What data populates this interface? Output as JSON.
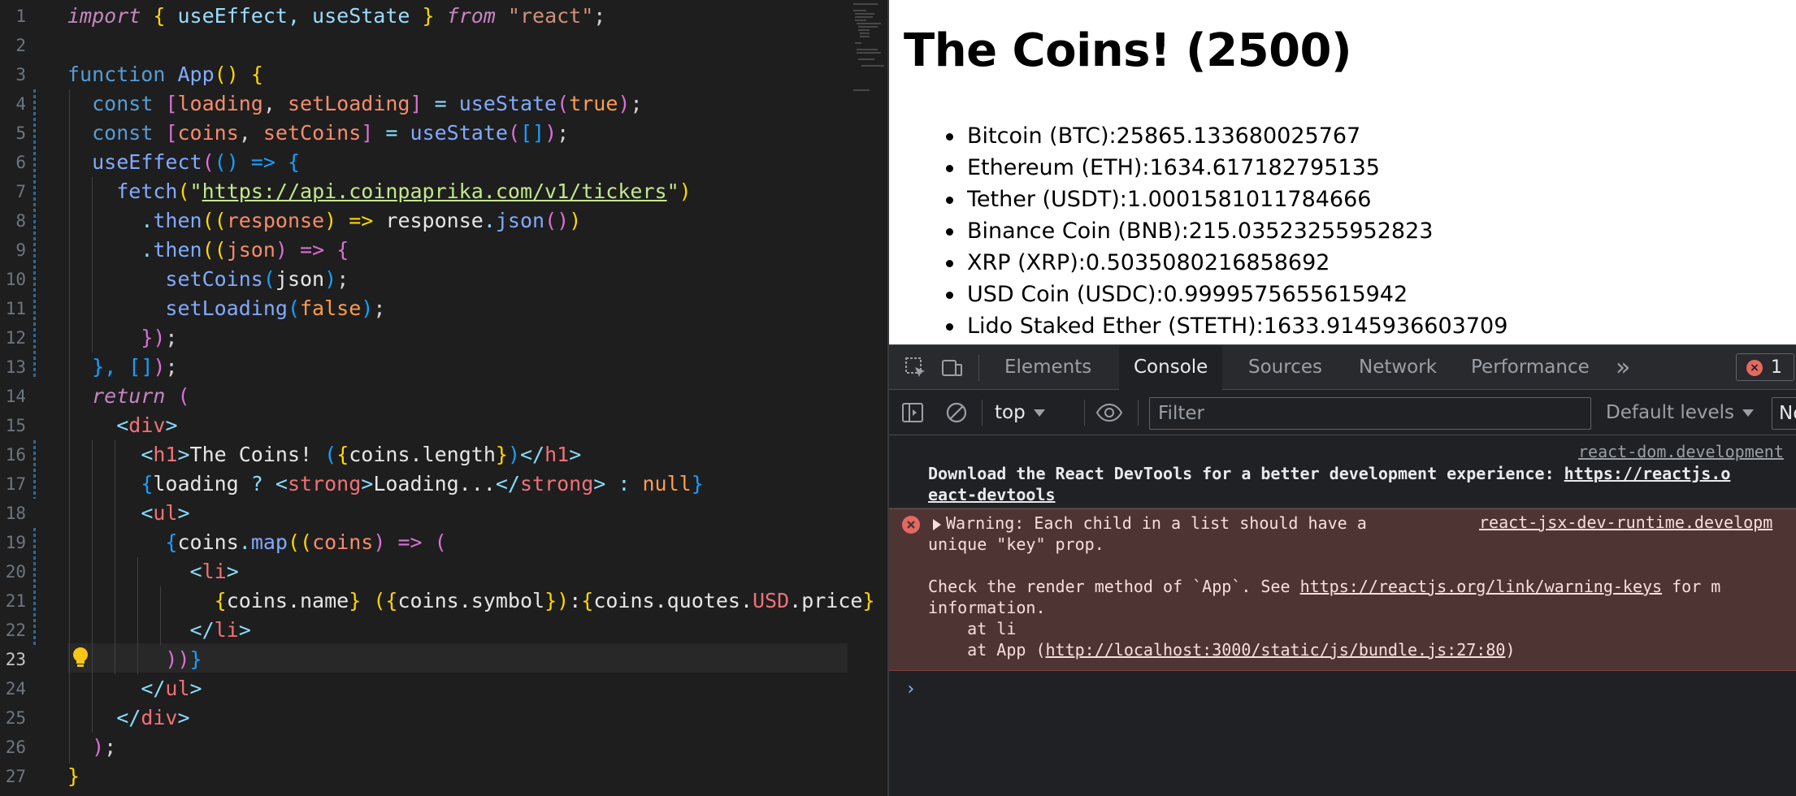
{
  "editor": {
    "line_numbers": [
      "1",
      "2",
      "3",
      "4",
      "5",
      "6",
      "7",
      "8",
      "9",
      "10",
      "11",
      "12",
      "13",
      "14",
      "15",
      "16",
      "17",
      "18",
      "19",
      "20",
      "21",
      "22",
      "23",
      "24",
      "25",
      "26",
      "27"
    ],
    "code": {
      "l1": {
        "import": "import",
        "open": "{",
        "names": " useEffect, useState ",
        "close": "}",
        "from": "from",
        "module": "\"react\"",
        "semi": ";"
      },
      "l3": {
        "function": "function",
        "name": "App",
        "parens": "()",
        "brace": "{"
      },
      "l4": {
        "const": "const",
        "open": "[",
        "a": "loading",
        "comma": ", ",
        "b": "setLoading",
        "close": "]",
        "eq": " = ",
        "fn": "useState",
        "p1": "(",
        "arg": "true",
        "p2": ")",
        "semi": ";"
      },
      "l5": {
        "const": "const",
        "open": "[",
        "a": "coins",
        "comma": ", ",
        "b": "setCoins",
        "close": "]",
        "eq": " = ",
        "fn": "useState",
        "p1": "(",
        "arg": "[]",
        "p2": ")",
        "semi": ";"
      },
      "l6": {
        "fn": "useEffect",
        "p1": "(",
        "arrow": "() => ",
        "brace": "{"
      },
      "l7": {
        "fn": "fetch",
        "p1": "(",
        "q1": "\"",
        "url": "https://api.coinpaprika.com/v1/tickers",
        "q2": "\"",
        "p2": ")"
      },
      "l8": {
        "dot": ".",
        "then": "then",
        "p1": "((",
        "arg": "response",
        "mid": ") => ",
        "obj": "response",
        "dot2": ".",
        "json": "json",
        "call": "()",
        "p2": ")"
      },
      "l9": {
        "dot": ".",
        "then": "then",
        "p1": "((",
        "arg": "json",
        "mid": ") => ",
        "brace": "{"
      },
      "l10": {
        "fn": "setCoins",
        "p1": "(",
        "arg": "json",
        "p2": ")",
        "semi": ";"
      },
      "l11": {
        "fn": "setLoading",
        "p1": "(",
        "arg": "false",
        "p2": ")",
        "semi": ";"
      },
      "l12": {
        "close": "})",
        "semi": ";"
      },
      "l13": {
        "close": "}, ",
        "arr": "[]",
        "p": ")",
        "semi": ";"
      },
      "l14": {
        "return": "return",
        "p": "("
      },
      "l15": {
        "lt": "<",
        "tag": "div",
        "gt": ">"
      },
      "l16": {
        "lt": "<",
        "tag": "h1",
        "gt": ">",
        "text": "The Coins! ",
        "p1": "(",
        "b1": "{",
        "expr": "coins.length",
        "b2": "}",
        "p2": ")",
        "lt2": "</",
        "tag2": "h1",
        "gt2": ">"
      },
      "l17": {
        "b1": "{",
        "cond": "loading",
        "q": " ? ",
        "lt": "<",
        "tag": "strong",
        "gt": ">",
        "text": "Loading...",
        "lt2": "</",
        "tag2": "strong",
        "gt2": ">",
        "colon": " : ",
        "null": "null",
        "b2": "}"
      },
      "l18": {
        "lt": "<",
        "tag": "ul",
        "gt": ">"
      },
      "l19": {
        "b1": "{",
        "obj": "coins",
        "dot": ".",
        "fn": "map",
        "p1": "((",
        "arg": "coins",
        "mid": ") => ",
        "p2": "("
      },
      "l20": {
        "lt": "<",
        "tag": "li",
        "gt": ">"
      },
      "l21": {
        "b1": "{",
        "e1": "coins.name",
        "b2": "}",
        "sp": " ",
        "p1": "(",
        "b3": "{",
        "e2": "coins.symbol",
        "b4": "}",
        "p2": ")",
        "colon": ":",
        "b5": "{",
        "e3a": "coins.quotes.",
        "usd": "USD",
        "e3b": ".price",
        "b6": "}"
      },
      "l22": {
        "lt": "</",
        "tag": "li",
        "gt": ">"
      },
      "l23": {
        "close": "))",
        "brace": "}"
      },
      "l24": {
        "lt": "</",
        "tag": "ul",
        "gt": ">"
      },
      "l25": {
        "lt": "</",
        "tag": "div",
        "gt": ">"
      },
      "l26": {
        "p": ")",
        "semi": ";"
      },
      "l27": {
        "brace": "}"
      }
    }
  },
  "page": {
    "heading": "The Coins! (2500)",
    "coins": [
      "Bitcoin (BTC):25865.133680025767",
      "Ethereum (ETH):1634.617182795135",
      "Tether (USDT):1.0001581011784666",
      "Binance Coin (BNB):215.03523255952823",
      "XRP (XRP):0.5035080216858692",
      "USD Coin (USDC):0.9999575655615942",
      "Lido Staked Ether (STETH):1633.9145936603709"
    ]
  },
  "devtools": {
    "tabs": [
      "Elements",
      "Console",
      "Sources",
      "Network",
      "Performance"
    ],
    "active_tab": "Console",
    "more_tabs": "»",
    "error_count": "1",
    "context": "top",
    "filter_placeholder": "Filter",
    "levels": "Default levels",
    "no_issues": "No",
    "messages": {
      "info_source": "react-dom.development",
      "info_line1_text": "Download the React DevTools for a better development experience: ",
      "info_line1_link": "https://reactjs.o",
      "info_line2_link": "eact-devtools",
      "warn_source": "react-jsx-dev-runtime.developm",
      "warn_line1": "Warning: Each child in a list should have a",
      "warn_line2": "unique \"key\" prop.",
      "warn_line3_text": "Check the render method of `App`. See ",
      "warn_line3_link": "https://reactjs.org/link/warning-keys",
      "warn_line3_tail": " for m",
      "warn_line4": "information.",
      "warn_line5": "    at li",
      "warn_line6_text": "    at App (",
      "warn_line6_link": "http://localhost:3000/static/js/bundle.js:27:80",
      "warn_line6_tail": ")"
    },
    "prompt": "›"
  },
  "colors": {
    "editor_bg": "#1e1e1e",
    "devtools_bg": "#202124",
    "error_bg": "#4e3534",
    "error_red": "#e46962"
  }
}
